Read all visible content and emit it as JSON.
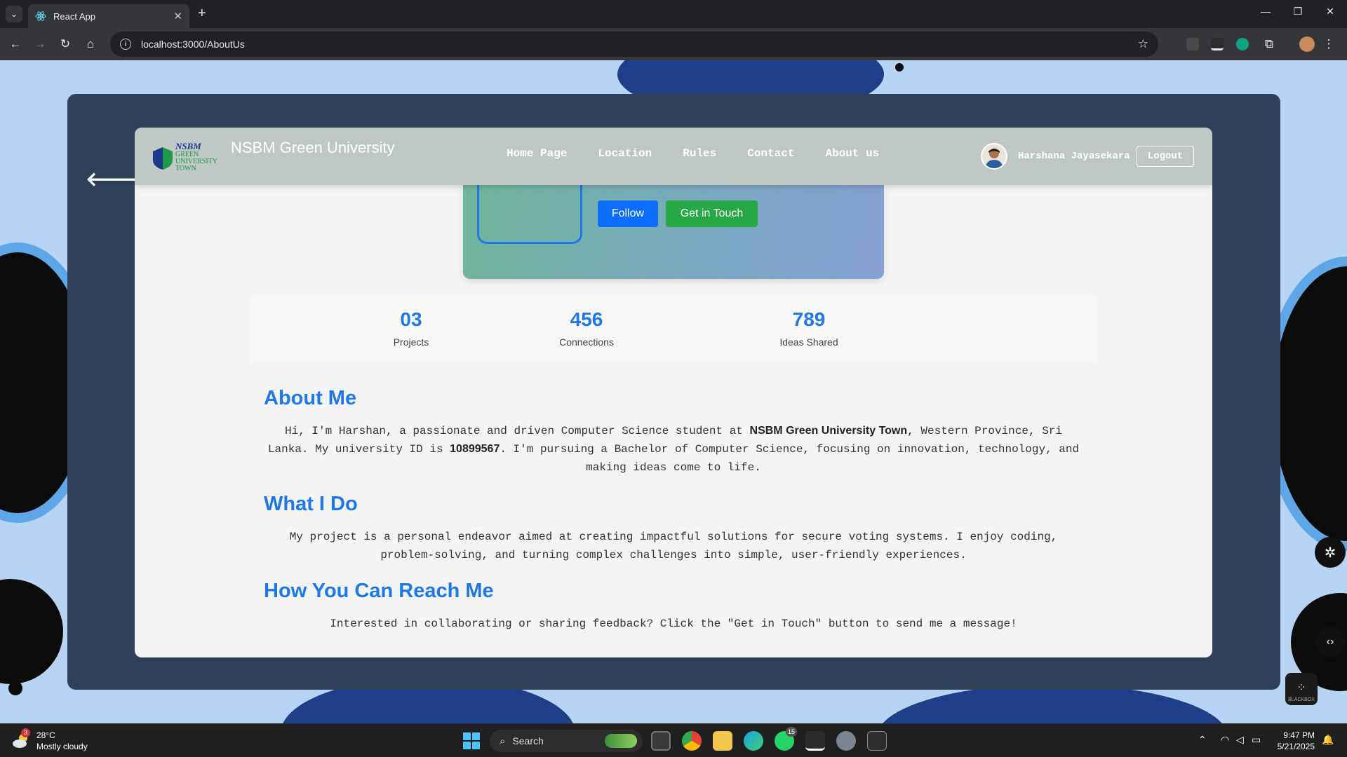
{
  "browser": {
    "tab_title": "React App",
    "url": "localhost:3000/AboutUs"
  },
  "navbar": {
    "logo_text_1": "NSBM",
    "logo_text_2": "GREEN",
    "logo_text_3": "UNIVERSITY",
    "logo_text_4": "TOWN",
    "brand": "NSBM Green University",
    "links": [
      "Home Page",
      "Location",
      "Rules",
      "Contact",
      "About us"
    ],
    "username": "Harshana Jayasekara",
    "logout_label": "Logout"
  },
  "profile": {
    "follow_label": "Follow",
    "touch_label": "Get in Touch"
  },
  "stats": [
    {
      "value": "03",
      "label": "Projects"
    },
    {
      "value": "456",
      "label": "Connections"
    },
    {
      "value": "789",
      "label": "Ideas Shared"
    }
  ],
  "sections": {
    "about_title": "About Me",
    "about_p1": "Hi, I'm Harshan, a passionate and driven Computer Science student at ",
    "about_b1": "NSBM Green University Town",
    "about_p2": ", Western Province, Sri Lanka. My university ID is ",
    "about_b2": "10899567",
    "about_p3": ". I'm pursuing a Bachelor of Computer Science, focusing on innovation, technology, and making ideas come to life.",
    "what_title": "What I Do",
    "what_body": "My project is a personal endeavor aimed at creating impactful solutions for secure voting systems. I enjoy coding, problem-solving, and turning complex challenges into simple, user-friendly experiences.",
    "reach_title": "How You Can Reach Me",
    "reach_body": "Interested in collaborating or sharing feedback? Click the \"Get in Touch\" button to send me a message!"
  },
  "taskbar": {
    "weather_badge": "3",
    "temperature": "28°C",
    "weather_desc": "Mostly cloudy",
    "search_placeholder": "Search",
    "whatsapp_badge": "15",
    "time": "9:47 PM",
    "date": "5/21/2025"
  },
  "widgets": {
    "blackbox_label": "BLACKBOX"
  },
  "colors": {
    "accent_blue": "#1e78e6",
    "follow_blue": "#0d6efd",
    "touch_green": "#28a745",
    "navbar_bg": "#bfc8c4",
    "outer_card": "#2f4058"
  }
}
